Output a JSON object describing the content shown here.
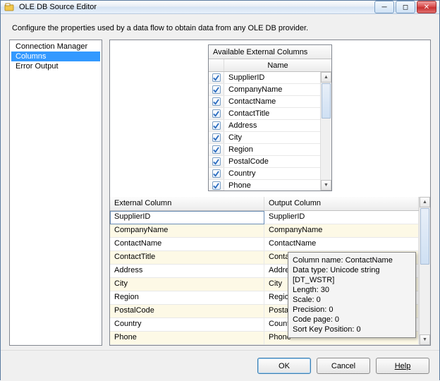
{
  "window": {
    "title": "OLE DB Source Editor"
  },
  "description": "Configure the properties used by a data flow to obtain data from any OLE DB provider.",
  "sidebar": {
    "items": [
      {
        "label": "Connection Manager",
        "selected": false
      },
      {
        "label": "Columns",
        "selected": true
      },
      {
        "label": "Error Output",
        "selected": false
      }
    ]
  },
  "availableColumns": {
    "header": "Available External Columns",
    "nameHeader": "Name",
    "items": [
      {
        "label": "SupplierID",
        "checked": true
      },
      {
        "label": "CompanyName",
        "checked": true
      },
      {
        "label": "ContactName",
        "checked": true
      },
      {
        "label": "ContactTitle",
        "checked": true
      },
      {
        "label": "Address",
        "checked": true
      },
      {
        "label": "City",
        "checked": true
      },
      {
        "label": "Region",
        "checked": true
      },
      {
        "label": "PostalCode",
        "checked": true
      },
      {
        "label": "Country",
        "checked": true
      },
      {
        "label": "Phone",
        "checked": true
      }
    ]
  },
  "grid": {
    "headers": {
      "external": "External Column",
      "output": "Output Column"
    },
    "rows": [
      {
        "external": "SupplierID",
        "output": "SupplierID",
        "edit": true
      },
      {
        "external": "CompanyName",
        "output": "CompanyName"
      },
      {
        "external": "ContactName",
        "output": "ContactName"
      },
      {
        "external": "ContactTitle",
        "output": "ContactTitle"
      },
      {
        "external": "Address",
        "output": "Address"
      },
      {
        "external": "City",
        "output": "City"
      },
      {
        "external": "Region",
        "output": "Region"
      },
      {
        "external": "PostalCode",
        "output": "PostalCode"
      },
      {
        "external": "Country",
        "output": "Country"
      },
      {
        "external": "Phone",
        "output": "Phone"
      }
    ]
  },
  "tooltip": {
    "lines": [
      "Column name: ContactName",
      "Data type: Unicode string [DT_WSTR]",
      "Length: 30",
      "Scale: 0",
      "Precision: 0",
      "Code page: 0",
      "Sort Key Position: 0"
    ]
  },
  "buttons": {
    "ok": "OK",
    "cancel": "Cancel",
    "help": "Help"
  }
}
